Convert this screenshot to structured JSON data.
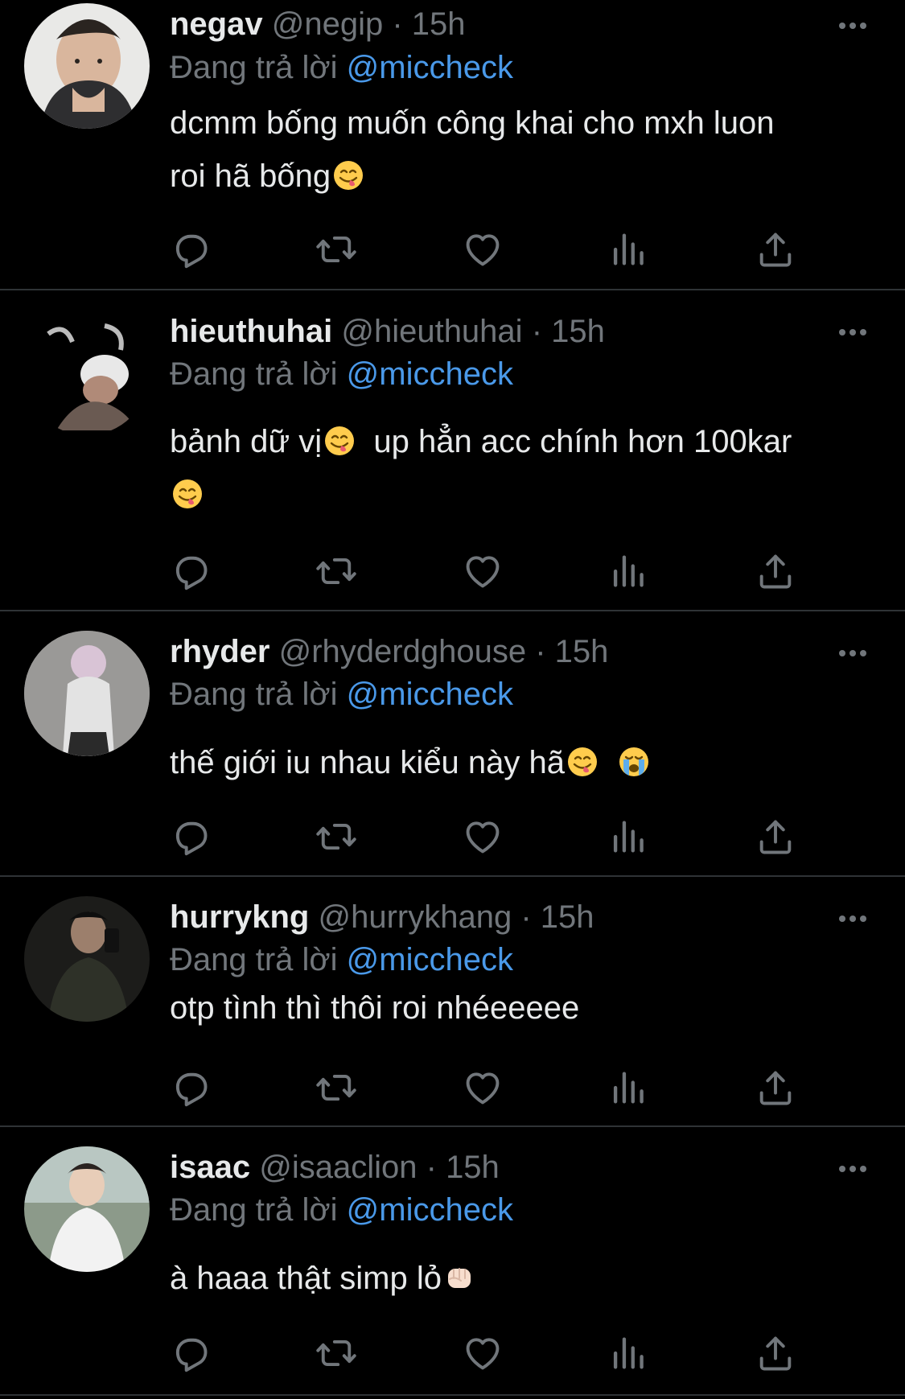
{
  "colors": {
    "background": "#000000",
    "text": "#e7e9ea",
    "muted": "#71767b",
    "link": "#4a99e9",
    "divider": "#2f3336"
  },
  "replies": [
    {
      "name": "negav",
      "handle": "@negip",
      "sep": "·",
      "time": "15h",
      "replying_prefix": "Đang trả lời",
      "replying_to": "@miccheck",
      "text_lines": [
        "dcmm bống muốn công khai cho mxh luon",
        "roi hã bống"
      ],
      "emojis": [
        "face-savoring-food"
      ]
    },
    {
      "name": "hieuthuhai",
      "handle": "@hieuthuhai",
      "sep": "·",
      "time": "15h",
      "replying_prefix": "Đang trả lời",
      "replying_to": "@miccheck",
      "text_a": "bảnh dữ vị",
      "text_b": "  up hẳn acc chính hơn 100kar",
      "emojis": [
        "face-savoring-food",
        "face-savoring-food"
      ]
    },
    {
      "name": "rhyder",
      "handle": "@rhyderdghouse",
      "sep": "·",
      "time": "15h",
      "replying_prefix": "Đang trả lời",
      "replying_to": "@miccheck",
      "text": "thế giới iu nhau kiểu này hã",
      "emojis": [
        "face-savoring-food",
        "loudly-crying-face"
      ]
    },
    {
      "name": "hurrykng",
      "handle": "@hurrykhang",
      "sep": "·",
      "time": "15h",
      "replying_prefix": "Đang trả lời",
      "replying_to": "@miccheck",
      "text": "otp tình thì thôi roi nhéeeeee",
      "emojis": []
    },
    {
      "name": "isaac",
      "handle": "@isaaclion",
      "sep": "·",
      "time": "15h",
      "replying_prefix": "Đang trả lời",
      "replying_to": "@miccheck",
      "text": "à haaa thật simp lỏ",
      "emojis": [
        "oncoming-fist"
      ]
    }
  ],
  "action_icons": [
    "reply-icon",
    "retweet-icon",
    "like-icon",
    "views-icon",
    "share-icon"
  ]
}
